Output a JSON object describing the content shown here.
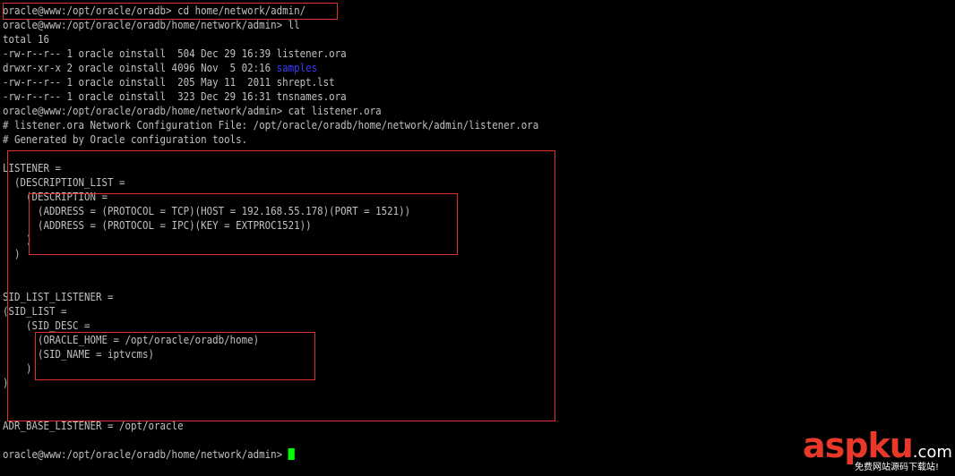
{
  "terminal": {
    "lines": [
      [
        {
          "text": "oracle@www:/opt/oracle/oradb> cd home/network/admin/"
        }
      ],
      [
        {
          "text": "oracle@www:/opt/oracle/oradb/home/network/admin> ll"
        }
      ],
      [
        {
          "text": "total 16"
        }
      ],
      [
        {
          "text": "-rw-r--r-- 1 oracle oinstall  504 Dec 29 16:39 listener.ora"
        }
      ],
      [
        {
          "text": "drwxr-xr-x 2 oracle oinstall 4096 Nov  5 02:16 "
        },
        {
          "text": "samples",
          "color": "blue"
        }
      ],
      [
        {
          "text": "-rw-r--r-- 1 oracle oinstall  205 May 11  2011 shrept.lst"
        }
      ],
      [
        {
          "text": "-rw-r--r-- 1 oracle oinstall  323 Dec 29 16:31 tnsnames.ora"
        }
      ],
      [
        {
          "text": "oracle@www:/opt/oracle/oradb/home/network/admin> cat listener.ora"
        }
      ],
      [
        {
          "text": "# listener.ora Network Configuration File: /opt/oracle/oradb/home/network/admin/listener.ora"
        }
      ],
      [
        {
          "text": "# Generated by Oracle configuration tools."
        }
      ],
      [
        {
          "text": ""
        }
      ],
      [
        {
          "text": "LISTENER ="
        }
      ],
      [
        {
          "text": "  (DESCRIPTION_LIST ="
        }
      ],
      [
        {
          "text": "    (DESCRIPTION ="
        }
      ],
      [
        {
          "text": "      (ADDRESS = (PROTOCOL = TCP)(HOST = 192.168.55.178)(PORT = 1521))"
        }
      ],
      [
        {
          "text": "      (ADDRESS = (PROTOCOL = IPC)(KEY = EXTPROC1521))"
        }
      ],
      [
        {
          "text": "    )"
        }
      ],
      [
        {
          "text": "  )"
        }
      ],
      [
        {
          "text": ""
        }
      ],
      [
        {
          "text": ""
        }
      ],
      [
        {
          "text": "SID_LIST_LISTENER ="
        }
      ],
      [
        {
          "text": "(SID_LIST ="
        }
      ],
      [
        {
          "text": "    (SID_DESC ="
        }
      ],
      [
        {
          "text": "      (ORACLE_HOME = /opt/oracle/oradb/home)"
        }
      ],
      [
        {
          "text": "      (SID_NAME = iptvcms)"
        }
      ],
      [
        {
          "text": "    )"
        }
      ],
      [
        {
          "text": ")"
        }
      ],
      [
        {
          "text": ""
        }
      ],
      [
        {
          "text": ""
        }
      ],
      [
        {
          "text": "ADR_BASE_LISTENER = /opt/oracle"
        }
      ],
      [
        {
          "text": ""
        }
      ],
      [
        {
          "text": "oracle@www:/opt/oracle/oradb/home/network/admin> "
        },
        {
          "cursor": true
        }
      ]
    ]
  },
  "watermark": {
    "logo_asp": "asp",
    "logo_ku": "ku",
    "logo_dotcom": ".com",
    "tagline": "免费网站源码下载站!"
  },
  "colors": {
    "background": "#000000",
    "text": "#c0c0c0",
    "directory": "#3a3aff",
    "cursor": "#00ff00",
    "highlight_box": "#e03030",
    "watermark_red": "#e8382a"
  }
}
